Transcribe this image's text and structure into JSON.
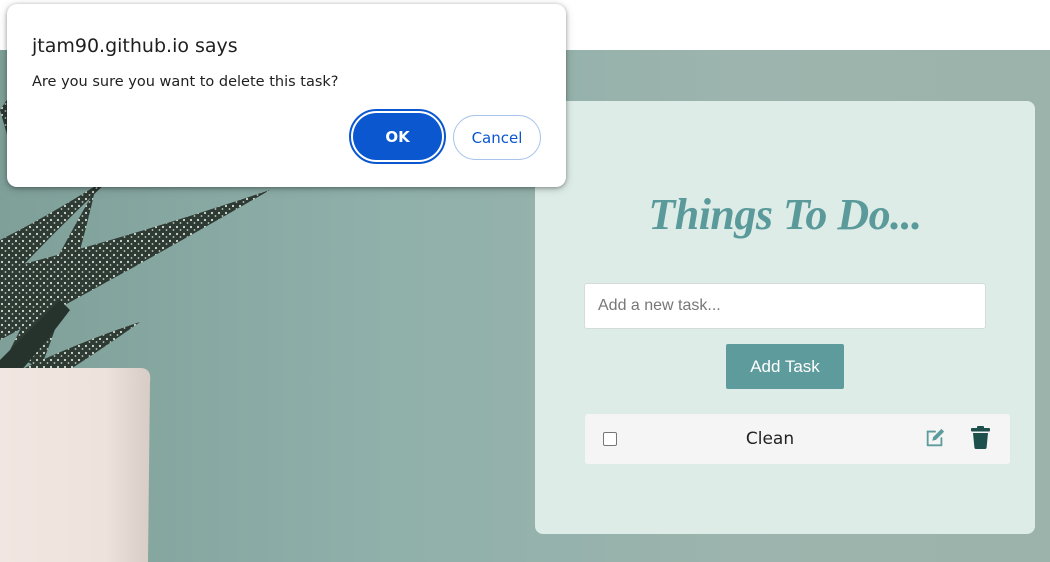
{
  "dialog": {
    "title": "jtam90.github.io says",
    "message": "Are you sure you want to delete this task?",
    "ok_label": "OK",
    "cancel_label": "Cancel",
    "accent_color": "#0b57d0"
  },
  "todo": {
    "title": "Things To Do...",
    "input": {
      "value": "",
      "placeholder": "Add a new task..."
    },
    "add_button_label": "Add Task",
    "tasks": [
      {
        "label": "Clean",
        "checked": false,
        "edit_icon": "edit-icon",
        "delete_icon": "trash-icon"
      }
    ],
    "colors": {
      "card": "#ddece7",
      "accent": "#5e9b9c",
      "trash": "#1d4f4c"
    }
  }
}
